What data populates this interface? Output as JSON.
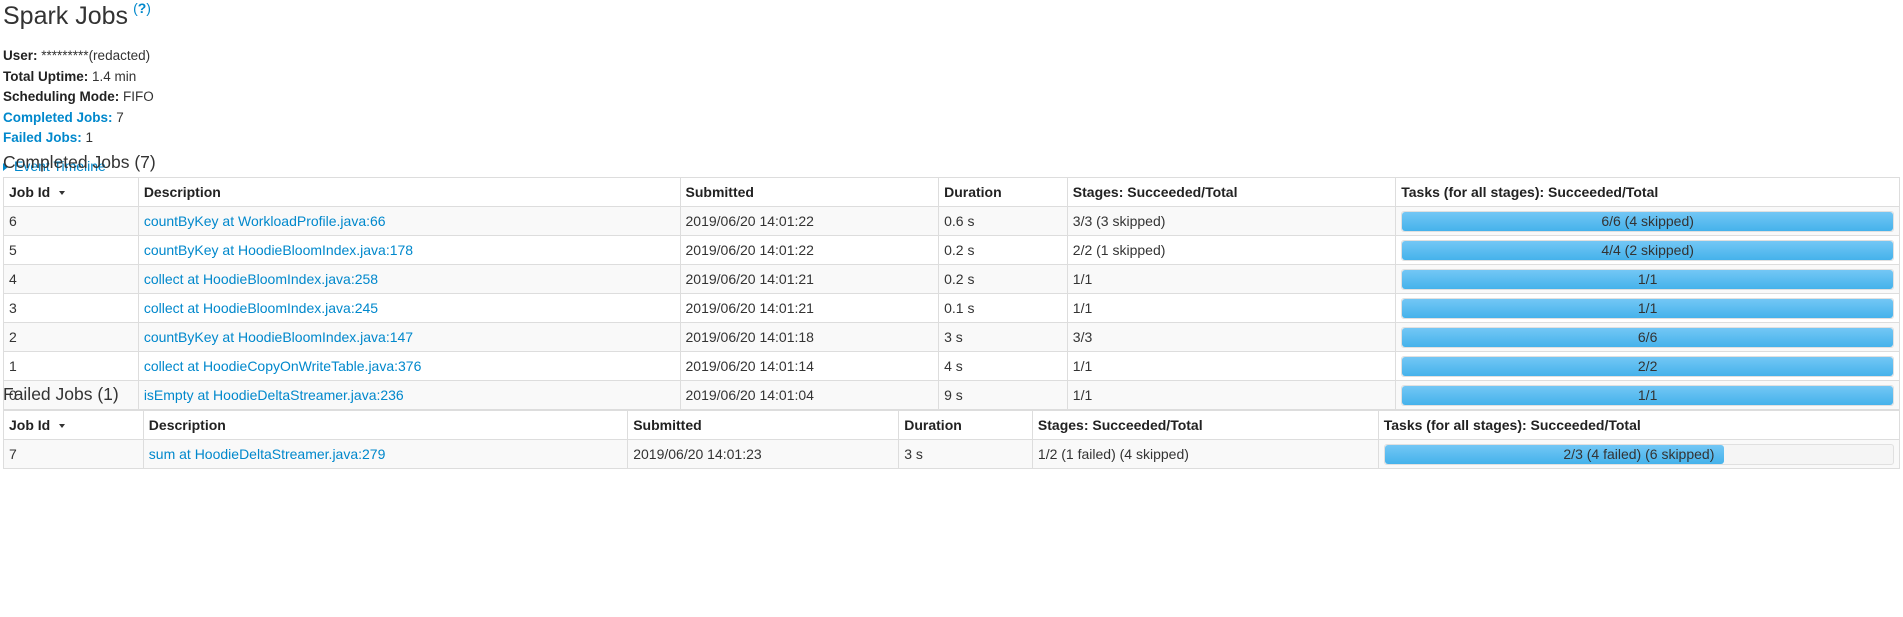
{
  "header": {
    "title": "Spark Jobs",
    "help_label": "?"
  },
  "summary": {
    "user_label": "User:",
    "user_value": "*********(redacted)",
    "uptime_label": "Total Uptime:",
    "uptime_value": "1.4 min",
    "scheduling_label": "Scheduling Mode:",
    "scheduling_value": "FIFO",
    "completed_label": "Completed Jobs:",
    "completed_value": "7",
    "failed_label": "Failed Jobs:",
    "failed_value": "1"
  },
  "timeline": {
    "label": "Event Timeline"
  },
  "completed_section": {
    "title": "Completed Jobs (7)",
    "columns": [
      "Job Id",
      "Description",
      "Submitted",
      "Duration",
      "Stages: Succeeded/Total",
      "Tasks (for all stages): Succeeded/Total"
    ],
    "rows": [
      {
        "id": "6",
        "description": "countByKey at WorkloadProfile.java:66",
        "submitted": "2019/06/20 14:01:22",
        "duration": "0.6 s",
        "stages": "3/3 (3 skipped)",
        "tasks": "6/6 (4 skipped)",
        "progress": 1.0
      },
      {
        "id": "5",
        "description": "countByKey at HoodieBloomIndex.java:178",
        "submitted": "2019/06/20 14:01:22",
        "duration": "0.2 s",
        "stages": "2/2 (1 skipped)",
        "tasks": "4/4 (2 skipped)",
        "progress": 1.0
      },
      {
        "id": "4",
        "description": "collect at HoodieBloomIndex.java:258",
        "submitted": "2019/06/20 14:01:21",
        "duration": "0.2 s",
        "stages": "1/1",
        "tasks": "1/1",
        "progress": 1.0
      },
      {
        "id": "3",
        "description": "collect at HoodieBloomIndex.java:245",
        "submitted": "2019/06/20 14:01:21",
        "duration": "0.1 s",
        "stages": "1/1",
        "tasks": "1/1",
        "progress": 1.0
      },
      {
        "id": "2",
        "description": "countByKey at HoodieBloomIndex.java:147",
        "submitted": "2019/06/20 14:01:18",
        "duration": "3 s",
        "stages": "3/3",
        "tasks": "6/6",
        "progress": 1.0
      },
      {
        "id": "1",
        "description": "collect at HoodieCopyOnWriteTable.java:376",
        "submitted": "2019/06/20 14:01:14",
        "duration": "4 s",
        "stages": "1/1",
        "tasks": "2/2",
        "progress": 1.0
      },
      {
        "id": "0",
        "description": "isEmpty at HoodieDeltaStreamer.java:236",
        "submitted": "2019/06/20 14:01:04",
        "duration": "9 s",
        "stages": "1/1",
        "tasks": "1/1",
        "progress": 1.0
      }
    ]
  },
  "failed_section": {
    "title": "Failed Jobs (1)",
    "columns": [
      "Job Id",
      "Description",
      "Submitted",
      "Duration",
      "Stages: Succeeded/Total",
      "Tasks (for all stages): Succeeded/Total"
    ],
    "rows": [
      {
        "id": "7",
        "description": "sum at HoodieDeltaStreamer.java:279",
        "submitted": "2019/06/20 14:01:23",
        "duration": "3 s",
        "stages": "1/2 (1 failed) (4 skipped)",
        "tasks": "2/3 (4 failed) (6 skipped)",
        "progress": 0.667
      }
    ]
  },
  "colors": {
    "link": "#0088cc",
    "progress_fill": "#45b2eb"
  }
}
